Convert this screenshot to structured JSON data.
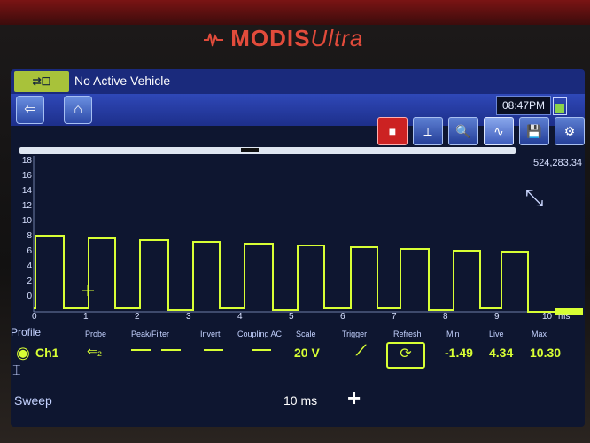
{
  "device": {
    "brand": "MODIS",
    "brand_suffix": "Ultra"
  },
  "titlebar": {
    "title": "No Active Vehicle",
    "icon_label": "⇄☐"
  },
  "navbar": {
    "time": "08:47PM"
  },
  "toolbar": {
    "buttons": [
      {
        "name": "stop-button",
        "glyph": "■"
      },
      {
        "name": "cursor-tool-button",
        "glyph": "⟂"
      },
      {
        "name": "zoom-button",
        "glyph": "🔍"
      },
      {
        "name": "scope-mode-button",
        "glyph": "∿"
      },
      {
        "name": "save-button",
        "glyph": "💾"
      },
      {
        "name": "settings-button",
        "glyph": "⚙"
      }
    ]
  },
  "plot": {
    "readout": "524,283.34",
    "y_ticks": [
      "18",
      "16",
      "14",
      "12",
      "10",
      "8",
      "6",
      "4",
      "2",
      "0"
    ],
    "x_ticks": [
      "0",
      "1",
      "2",
      "3",
      "4",
      "5",
      "6",
      "7",
      "8",
      "9",
      "10"
    ],
    "x_unit": "ms"
  },
  "headers": {
    "profile": "Profile",
    "probe": "Probe",
    "peak_filter": "Peak/Filter",
    "invert": "Invert",
    "coupling": "Coupling AC",
    "scale": "Scale",
    "trigger": "Trigger",
    "refresh": "Refresh",
    "min": "Min",
    "live": "Live",
    "max": "Max"
  },
  "channel": {
    "name": "Ch1",
    "scale": "20 V",
    "min": "-1.49",
    "live": "4.34",
    "max": "10.30"
  },
  "footer": {
    "sweep_label": "Sweep",
    "sweep_value": "10 ms"
  },
  "colors": {
    "trace": "#d8ff34",
    "accent": "#1d2f8a"
  }
}
